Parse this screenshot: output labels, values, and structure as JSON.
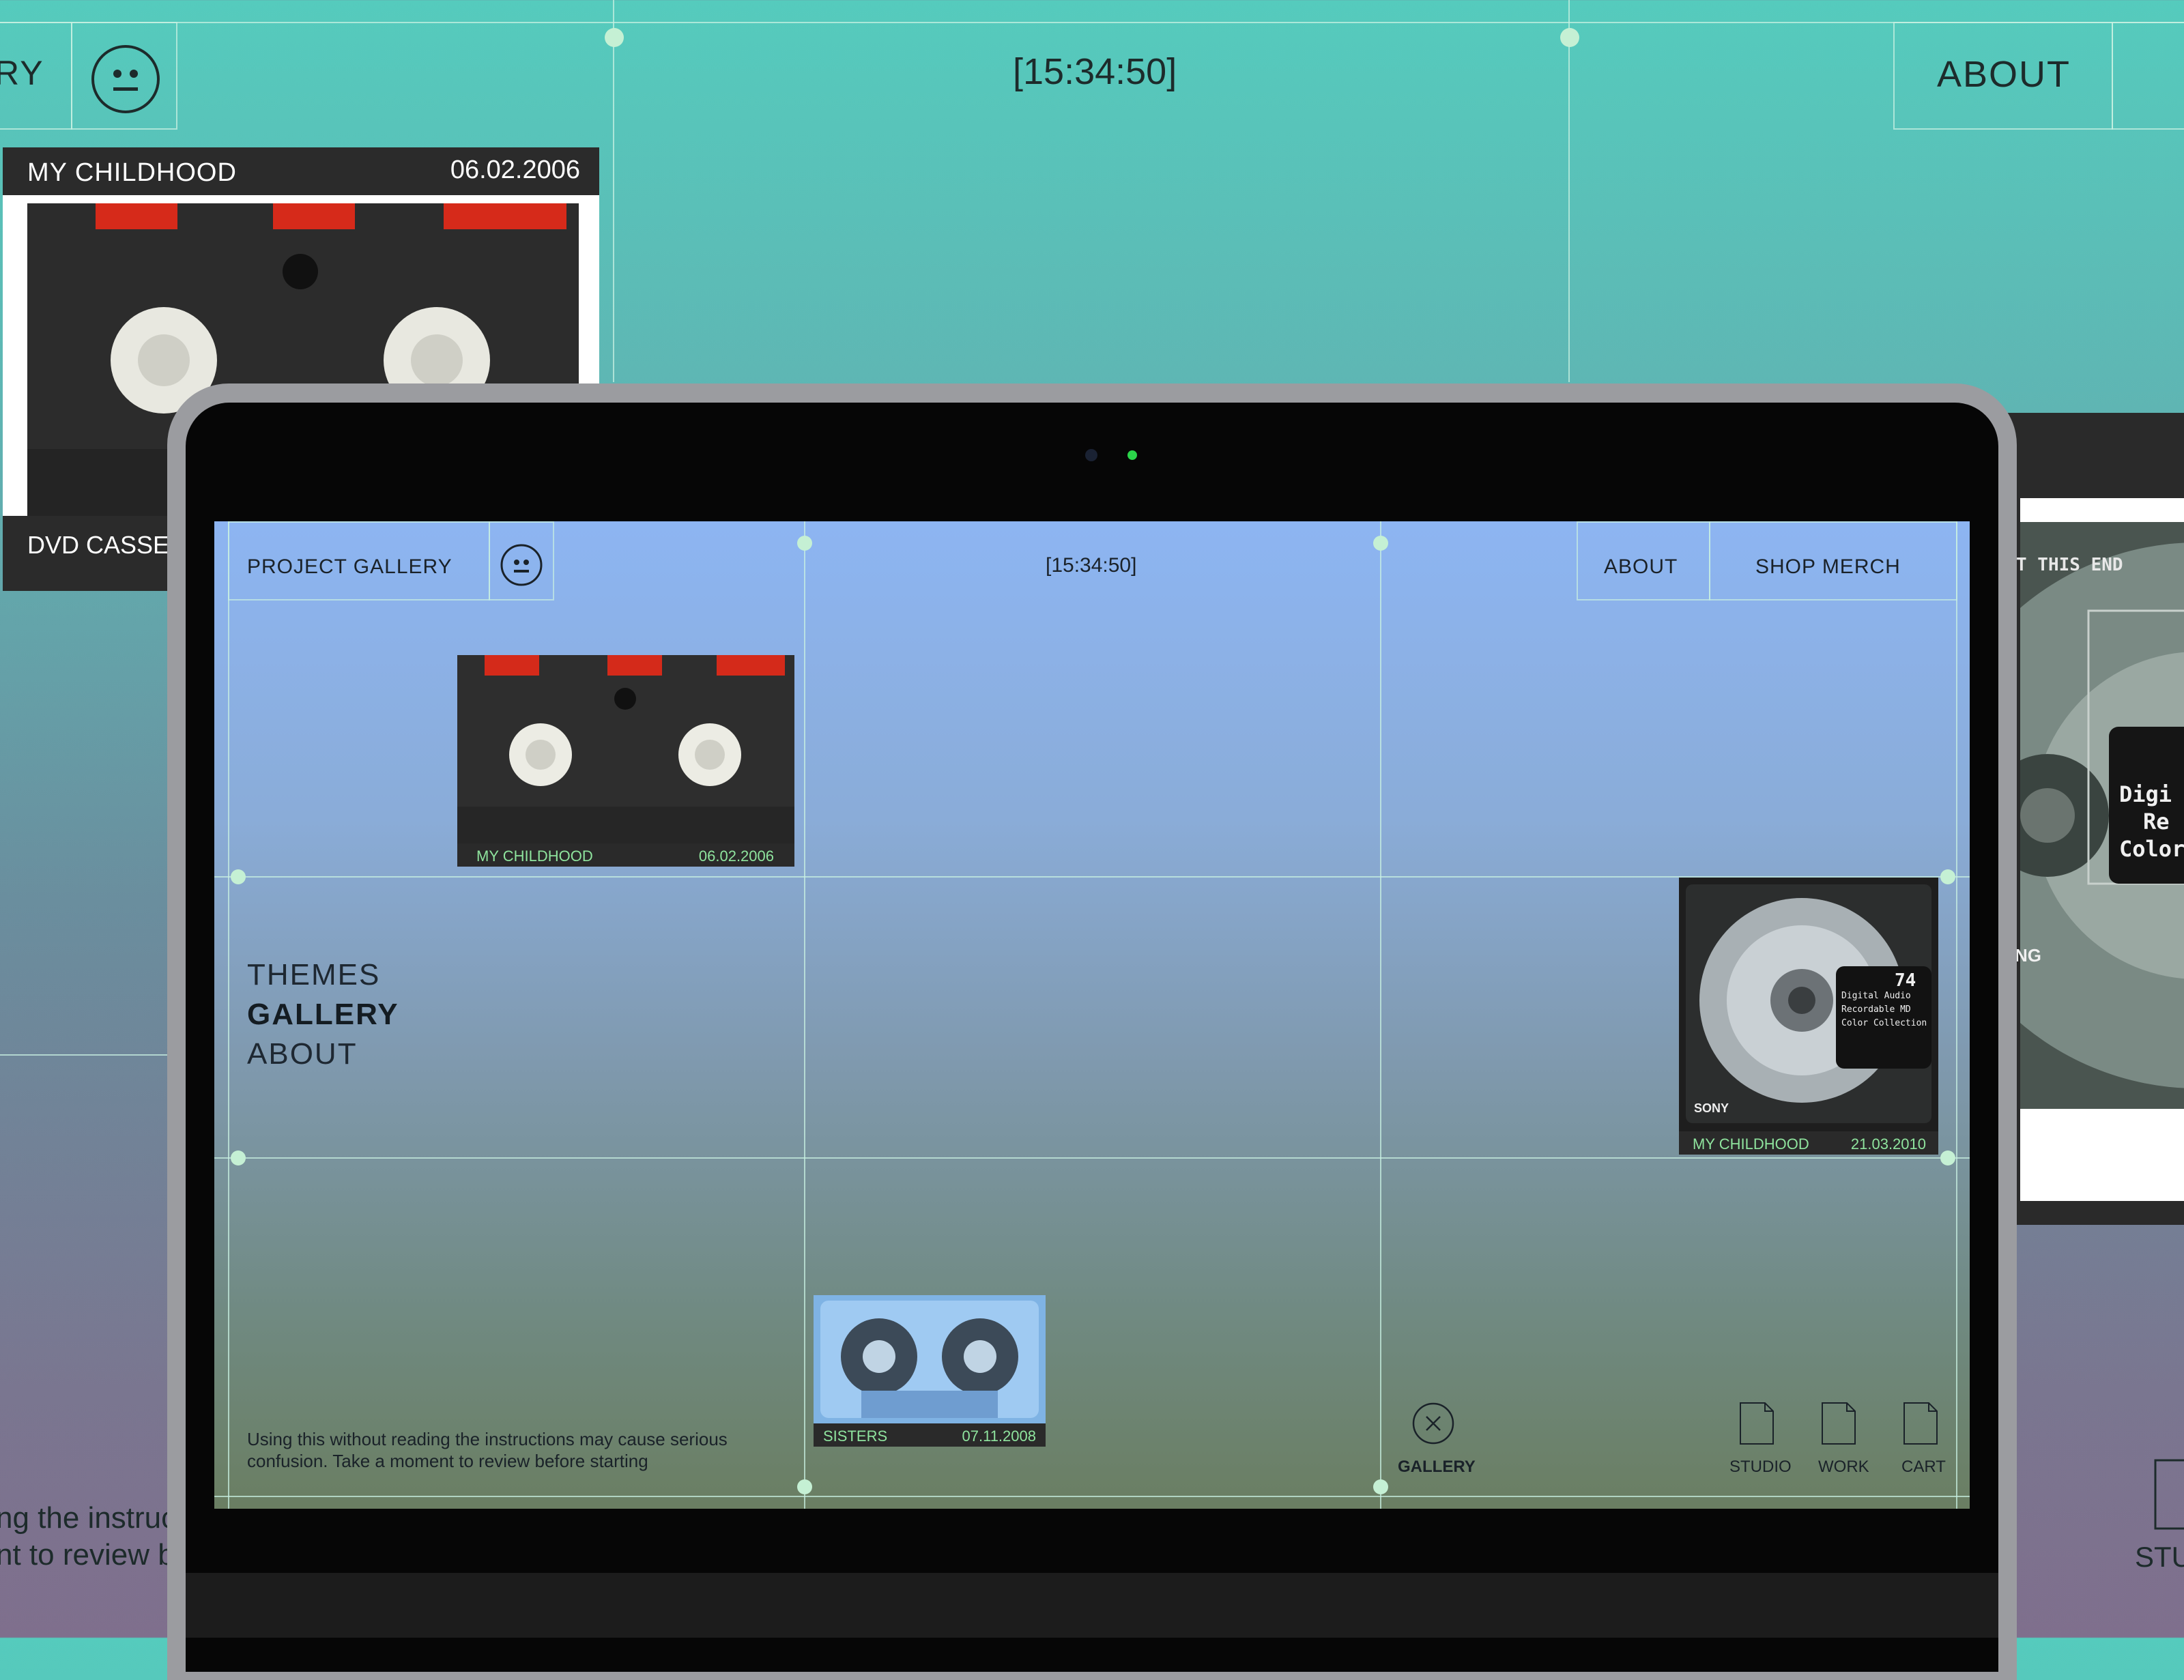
{
  "background_site": {
    "nav_partial_label": "RY",
    "time": "[15:34:50]",
    "about_label": "ABOUT",
    "card": {
      "title": "MY CHILDHOOD",
      "date": "06.02.2006",
      "footer_label": "DVD CASSET"
    },
    "instructions_line1": "ng the instruc",
    "instructions_line2": "nt to review b",
    "studio_partial": "STU"
  },
  "right_panel": {
    "label_top": "T THIS END",
    "label_lines": [
      "Digi",
      "Re",
      "Color"
    ],
    "brand_partial": "NG"
  },
  "screen": {
    "header": {
      "title": "PROJECT GALLERY",
      "time": "[15:34:50]",
      "about_label": "ABOUT",
      "shop_label": "SHOP MERCH"
    },
    "side_menu": [
      "THEMES",
      "GALLERY",
      "ABOUT"
    ],
    "items": [
      {
        "title": "MY CHILDHOOD",
        "date": "06.02.2006",
        "kind": "vhs-cassette"
      },
      {
        "title": "MY CHILDHOOD",
        "date": "21.03.2010",
        "kind": "minidisc"
      },
      {
        "title": "SISTERS",
        "date": "07.11.2008",
        "kind": "audio-cassette"
      }
    ],
    "minidisc_label": {
      "number": "74",
      "lines": [
        "Digital Audio",
        "Recordable MD",
        "Color Collection"
      ],
      "brand": "SONY"
    },
    "instructions": {
      "line1": "Using this without reading the instructions may cause serious",
      "line2": "confusion. Take a moment to review before starting"
    },
    "bottom_nav": {
      "gallery_label": "GALLERY",
      "studio_label": "STUDIO",
      "work_label": "WORK",
      "cart_label": "CART"
    }
  },
  "colors": {
    "grid_line": "#c8f0e1",
    "node": "#c5f0d4",
    "caption_text": "#8fe49e",
    "camera_led": "#2bd44a"
  }
}
